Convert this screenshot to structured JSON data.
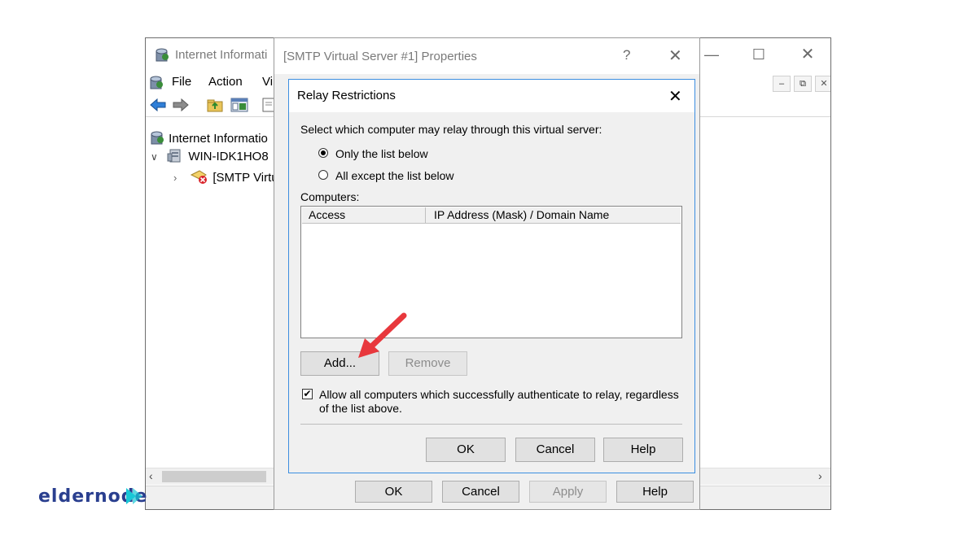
{
  "iis_window": {
    "title": "Internet Informati",
    "menu": {
      "file": "File",
      "action": "Action",
      "view": "Vi"
    },
    "tree": {
      "root": "Internet Informatio",
      "server": "WIN-IDK1HO8",
      "smtp": "[SMTP Virtu"
    }
  },
  "properties_dialog": {
    "title": "[SMTP Virtual Server #1] Properties",
    "buttons": {
      "ok": "OK",
      "cancel": "Cancel",
      "apply": "Apply",
      "help": "Help"
    }
  },
  "relay_dialog": {
    "title": "Relay Restrictions",
    "prompt": "Select which computer may relay through this virtual server:",
    "options": {
      "only_list": "Only the list below",
      "all_except": "All except the list below",
      "selected": "only_list"
    },
    "computers_label": "Computers:",
    "columns": {
      "access": "Access",
      "ip": "IP Address (Mask) / Domain Name"
    },
    "rows": [],
    "add_label": "Add...",
    "remove_label": "Remove",
    "authenticate": {
      "checked": true,
      "line1": "Allow all computers which successfully authenticate to relay, regardless",
      "line2": "of the list above."
    },
    "buttons": {
      "ok": "OK",
      "cancel": "Cancel",
      "help": "Help"
    }
  },
  "watermark": "eldernode",
  "colors": {
    "accent_border": "#3c8ee0",
    "arrow": "#e8383d",
    "watermark_blue": "#2a3f8f",
    "watermark_cyan": "#18c7d6"
  }
}
